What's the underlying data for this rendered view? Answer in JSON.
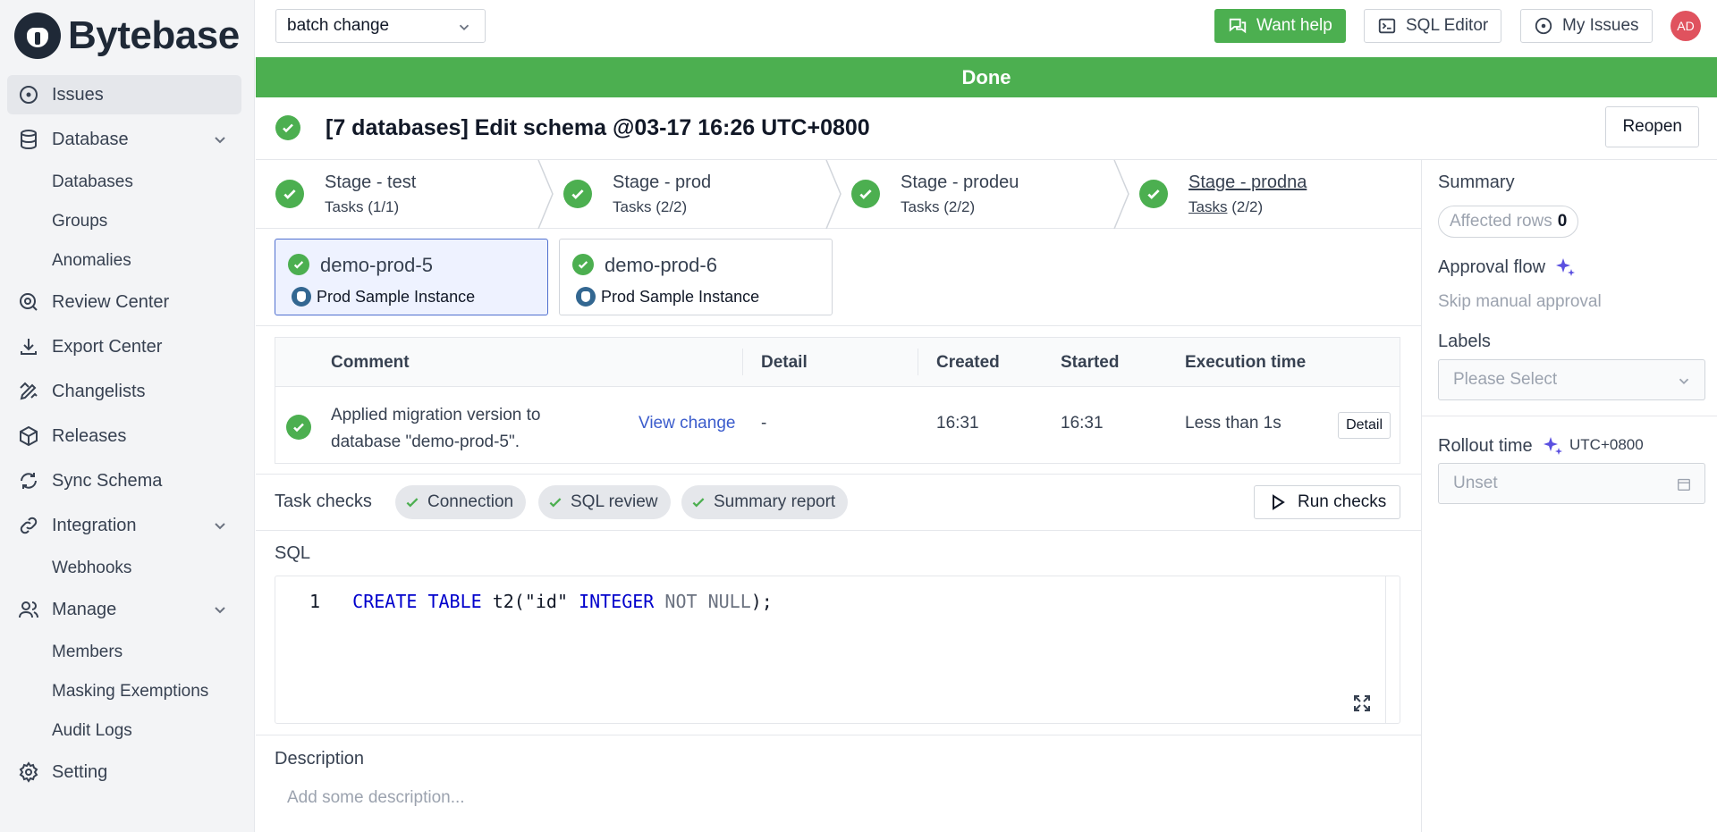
{
  "brand": {
    "name": "Bytebase"
  },
  "sidebar": {
    "items": [
      {
        "label": "Issues",
        "icon": "issues-circle-icon",
        "active": true
      },
      {
        "label": "Database",
        "icon": "database-icon",
        "expandable": true
      },
      {
        "label": "Databases",
        "sub": true
      },
      {
        "label": "Groups",
        "sub": true
      },
      {
        "label": "Anomalies",
        "sub": true
      },
      {
        "label": "Review Center",
        "icon": "review-search-icon"
      },
      {
        "label": "Export Center",
        "icon": "download-icon"
      },
      {
        "label": "Changelists",
        "icon": "changelist-icon"
      },
      {
        "label": "Releases",
        "icon": "package-icon"
      },
      {
        "label": "Sync Schema",
        "icon": "sync-icon"
      },
      {
        "label": "Integration",
        "icon": "link-icon",
        "expandable": true
      },
      {
        "label": "Webhooks",
        "sub": true
      },
      {
        "label": "Manage",
        "icon": "users-icon",
        "expandable": true
      },
      {
        "label": "Members",
        "sub": true
      },
      {
        "label": "Masking Exemptions",
        "sub": true
      },
      {
        "label": "Audit Logs",
        "sub": true
      },
      {
        "label": "Setting",
        "icon": "gear-icon"
      }
    ]
  },
  "topbar": {
    "project_select": "batch change",
    "want_help": "Want help",
    "sql_editor": "SQL Editor",
    "my_issues": "My Issues",
    "avatar_initials": "AD"
  },
  "banner": {
    "status": "Done"
  },
  "issue": {
    "title": "[7 databases] Edit schema @03-17 16:26 UTC+0800",
    "reopen": "Reopen"
  },
  "stages": [
    {
      "name": "Stage - test",
      "tasks_label": "Tasks",
      "tasks_count": "(1/1)"
    },
    {
      "name": "Stage - prod",
      "tasks_label": "Tasks",
      "tasks_count": "(2/2)"
    },
    {
      "name": "Stage - prodeu",
      "tasks_label": "Tasks",
      "tasks_count": "(2/2)"
    },
    {
      "name": "Stage - prodna",
      "tasks_label": "Tasks",
      "tasks_count": "(2/2)",
      "current": true
    }
  ],
  "tasks": [
    {
      "name": "demo-prod-5",
      "instance": "Prod Sample Instance",
      "selected": true
    },
    {
      "name": "demo-prod-6",
      "instance": "Prod Sample Instance",
      "selected": false
    }
  ],
  "task_runs": {
    "columns": [
      "Comment",
      "Detail",
      "Created",
      "Started",
      "Execution time"
    ],
    "rows": [
      {
        "comment": "Applied migration version to database \"demo-prod-5\".",
        "view_change": "View change",
        "detail": "-",
        "created": "16:31",
        "started": "16:31",
        "execution_time": "Less than 1s",
        "detail_button": "Detail"
      }
    ]
  },
  "task_checks": {
    "label": "Task checks",
    "checks": [
      "Connection",
      "SQL review",
      "Summary report"
    ],
    "run_button": "Run checks"
  },
  "sql": {
    "label": "SQL",
    "line_number": "1",
    "tokens": {
      "kw1": "CREATE TABLE",
      "ident": " t2",
      "open": "(",
      "col": "\"id\" ",
      "kw2": "INTEGER",
      "muted": " NOT NULL",
      "close": ");"
    }
  },
  "description": {
    "label": "Description",
    "placeholder": "Add some description..."
  },
  "right_panel": {
    "summary_label": "Summary",
    "affected_rows_label": "Affected rows",
    "affected_rows_value": "0",
    "approval_flow_label": "Approval flow",
    "approval_flow_value": "Skip manual approval",
    "labels_label": "Labels",
    "labels_placeholder": "Please Select",
    "rollout_time_label": "Rollout time",
    "rollout_tz": "UTC+0800",
    "rollout_placeholder": "Unset"
  },
  "colors": {
    "success": "#4caf50",
    "link": "#3b5ccc",
    "sparkle": "#5b50e0",
    "avatar": "#e0525e"
  }
}
